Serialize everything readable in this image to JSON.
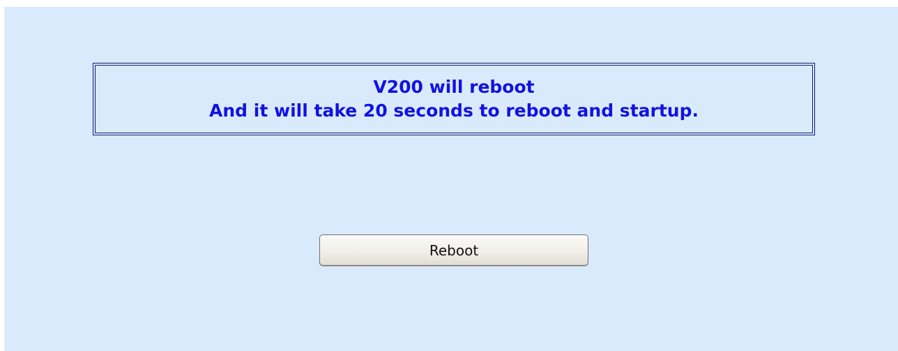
{
  "message": {
    "line1": "V200 will reboot",
    "line2": "And it will take 20 seconds to reboot and startup."
  },
  "actions": {
    "reboot_label": "Reboot"
  },
  "colors": {
    "background": "#d9eafd",
    "message_text": "#1212e0",
    "border": "#0a1a6a"
  }
}
